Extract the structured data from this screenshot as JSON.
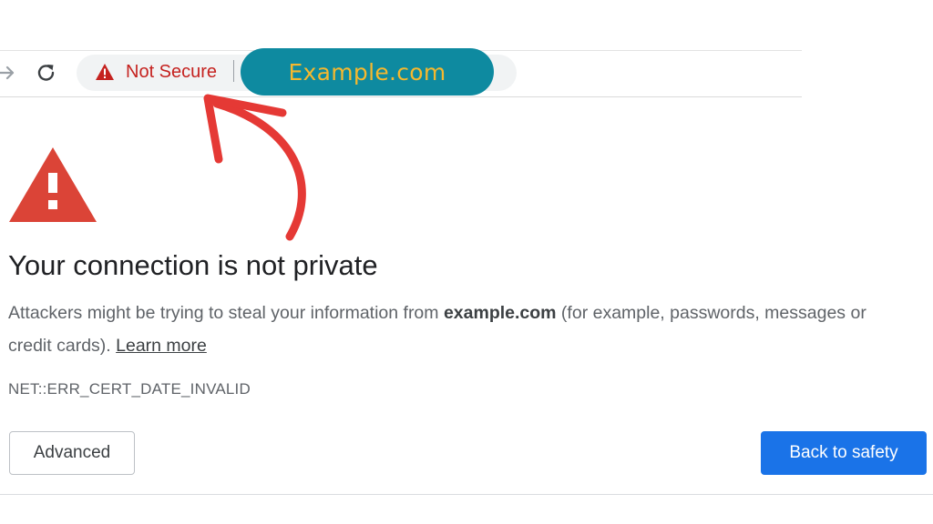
{
  "toolbar": {
    "forward_icon": "arrow-forward-icon",
    "reload_icon": "reload-icon",
    "security_icon": "warning-triangle-icon",
    "security_label": "Not Secure",
    "url_highlight": "Example.com"
  },
  "colors": {
    "danger": "#c5221f",
    "warning_red": "#db4437",
    "annotation_pill": "#0e8aa0",
    "annotation_text": "#f5b82e",
    "annotation_arrow": "#e53935",
    "primary_button": "#1a73e8"
  },
  "page": {
    "warning_icon": "warning-triangle-icon",
    "title": "Your connection is not private",
    "description_prefix": "Attackers might be trying to steal your information from ",
    "description_domain": "example.com",
    "description_suffix": " (for example, passwords, messages or credit cards). ",
    "learn_more": "Learn more",
    "error_code": "NET::ERR_CERT_DATE_INVALID",
    "advanced_button": "Advanced",
    "back_button": "Back to safety"
  }
}
